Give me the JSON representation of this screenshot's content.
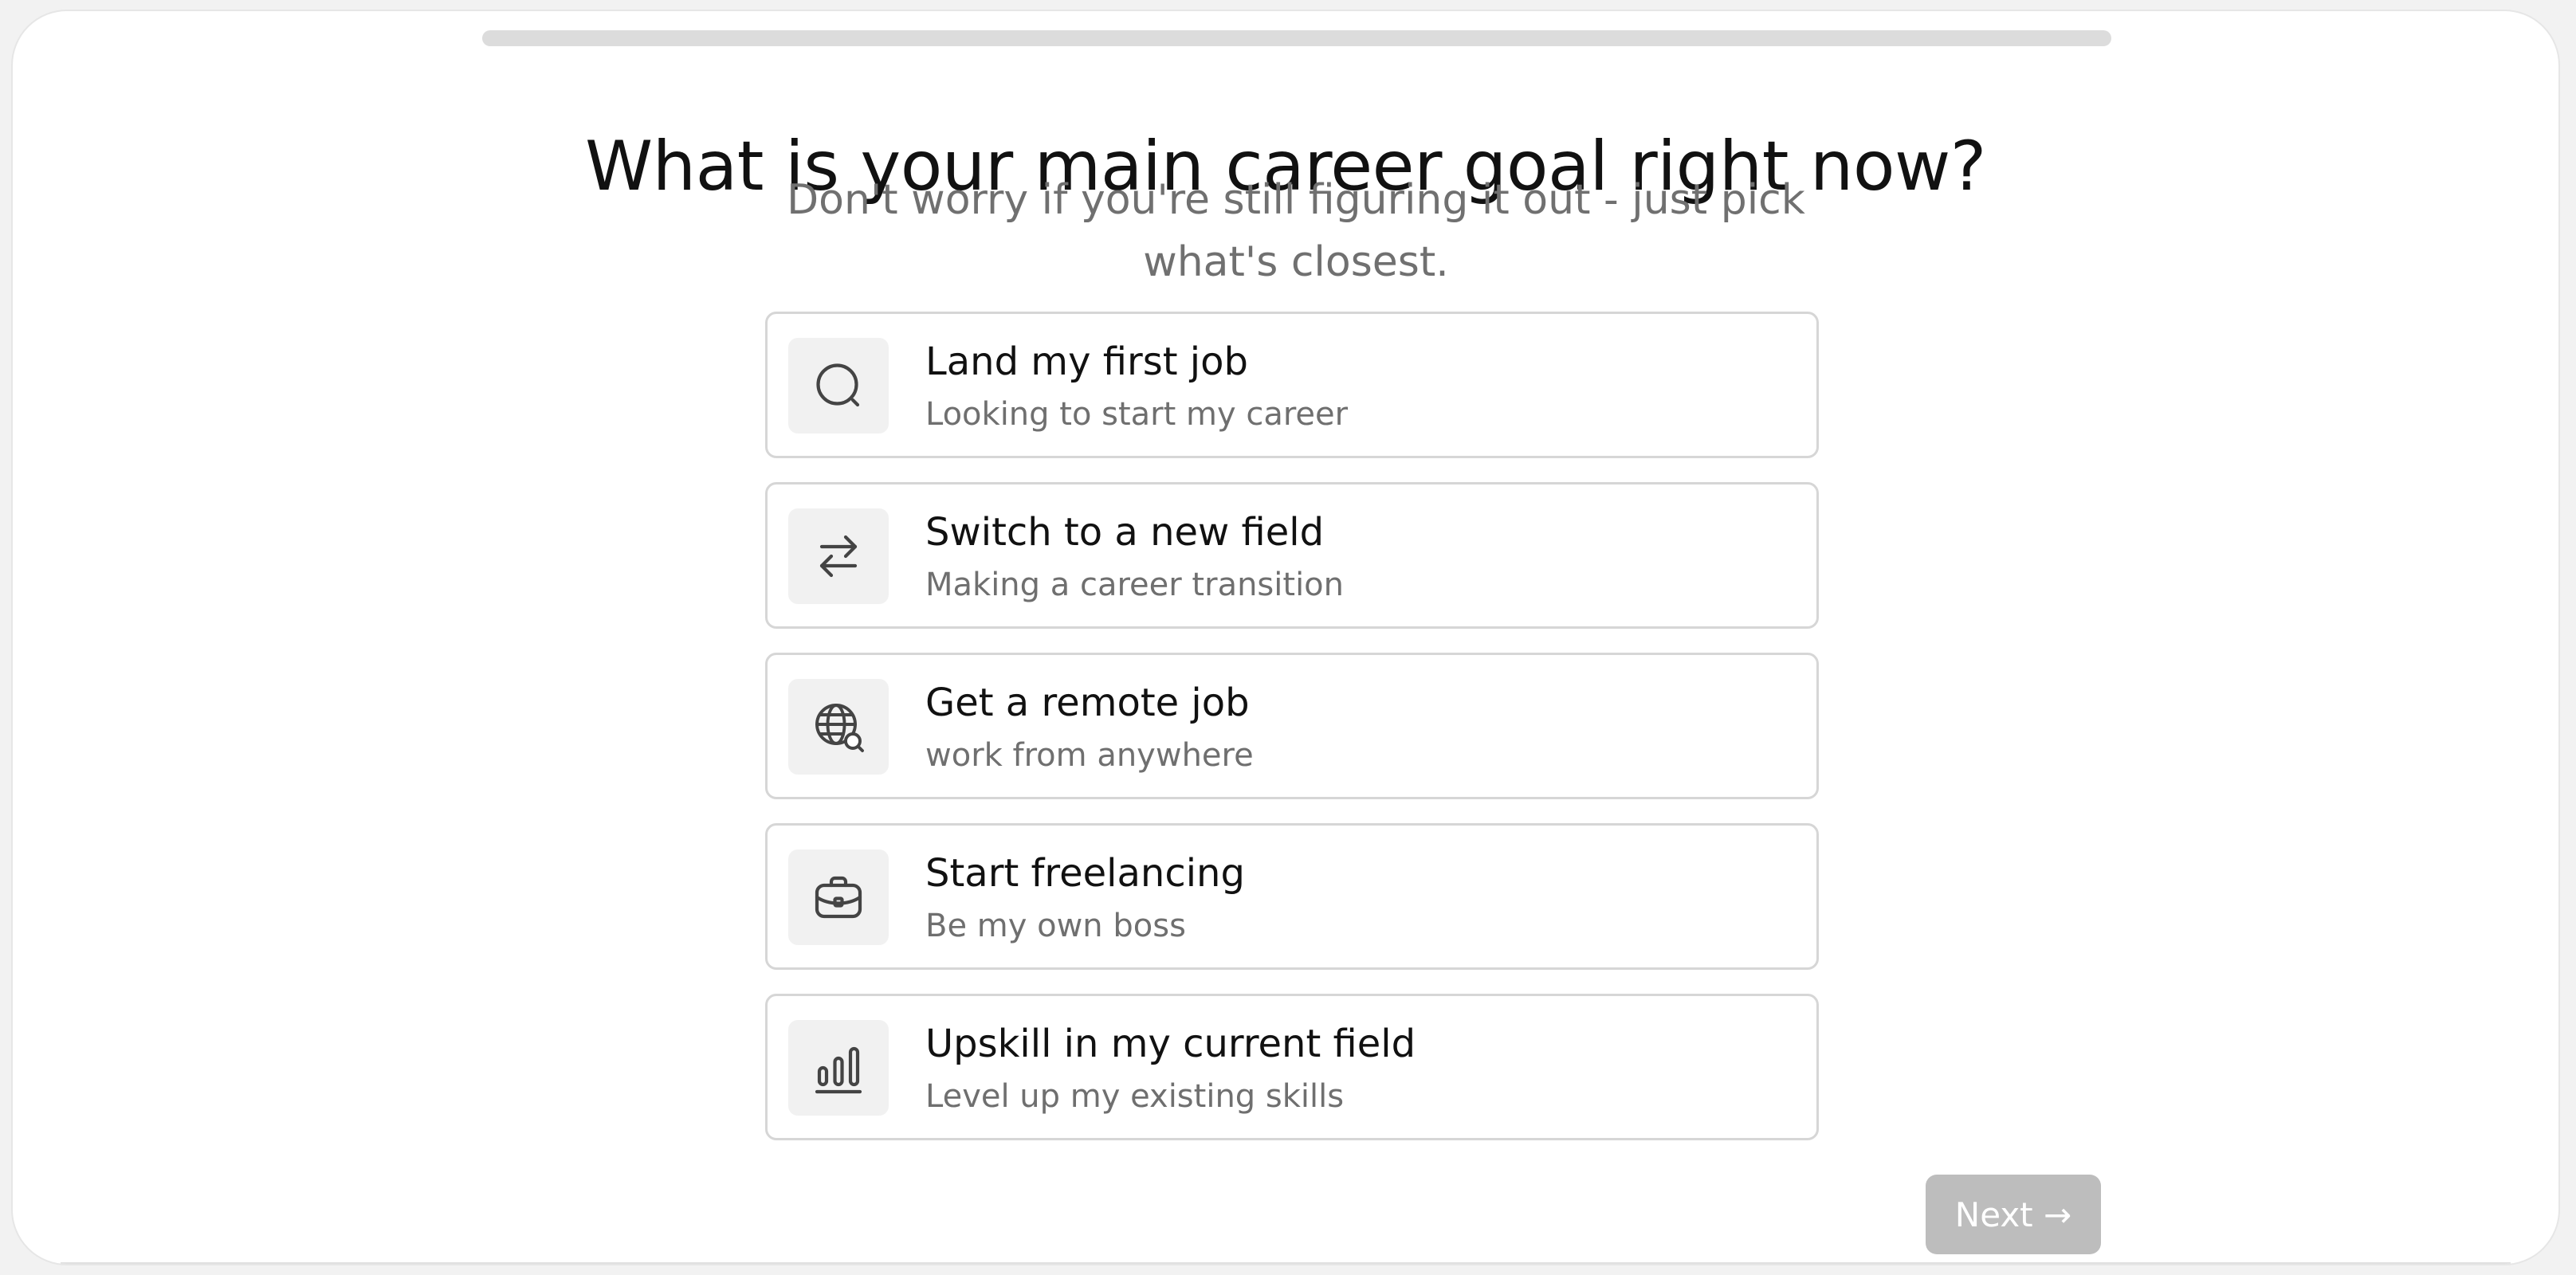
{
  "progress": {
    "fraction": 0.0
  },
  "question": {
    "title": "What is your main career goal right now?",
    "subtitle": "Don't worry if you're still figuring it out - just pick what's closest."
  },
  "options": [
    {
      "icon": "search-icon",
      "title": "Land my first job",
      "description": "Looking to start my career"
    },
    {
      "icon": "swap-arrows-icon",
      "title": "Switch to a new field",
      "description": "Making a career transition"
    },
    {
      "icon": "globe-search-icon",
      "title": "Get a remote job",
      "description": "work from anywhere"
    },
    {
      "icon": "briefcase-icon",
      "title": "Start freelancing",
      "description": "Be my own boss"
    },
    {
      "icon": "bar-chart-icon",
      "title": "Upskill in my current field",
      "description": "Level up my existing skills"
    }
  ],
  "next_button": {
    "label": "Next →"
  },
  "colors": {
    "background": "#ffffff",
    "border": "#d6d6d6",
    "icon_bg": "#f1f1f1",
    "title_text": "#111111",
    "muted_text": "#707070",
    "disabled_button": "#bdbdbd"
  }
}
